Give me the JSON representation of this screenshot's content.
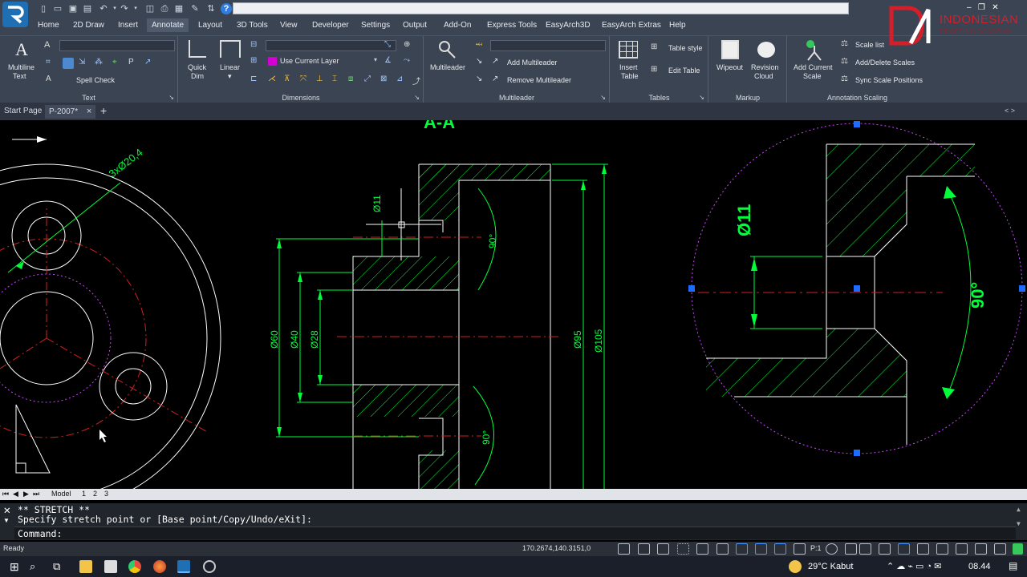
{
  "titlebar": {
    "brand_text": "INDONESIAN",
    "brand_subtext": "DRAFTING ACADEMY"
  },
  "menu": {
    "items": [
      "Home",
      "2D Draw",
      "Insert",
      "Annotate",
      "Layout",
      "3D Tools",
      "View",
      "Developer",
      "Settings",
      "Output",
      "Add-On",
      "Express Tools",
      "EasyArch3D",
      "EasyArch Extras",
      "Help"
    ],
    "active": "Annotate"
  },
  "ribbon": {
    "text": {
      "title": "Text",
      "multiline_text": "Multiline",
      "multiline_text2": "Text",
      "spell_check": "Spell Check"
    },
    "dimensions": {
      "title": "Dimensions",
      "quick_dim": "Quick",
      "quick_dim2": "Dim",
      "linear": "Linear",
      "layer": "Use Current Layer",
      "layer_color": "#d400d4"
    },
    "multileader": {
      "title": "Multileader",
      "multileader": "Multileader",
      "add": "Add Multileader",
      "remove": "Remove Multileader"
    },
    "tables": {
      "title": "Tables",
      "insert_table": "Insert",
      "insert_table2": "Table",
      "table_style": "Table style",
      "edit_table": "Edit Table"
    },
    "markup": {
      "title": "Markup",
      "wipeout": "Wipeout",
      "revision_cloud": "Revision",
      "revision_cloud2": "Cloud"
    },
    "annotation_scaling": {
      "title": "Annotation Scaling",
      "add_current_scale": "Add Current",
      "add_current_scale2": "Scale",
      "scale_list": "Scale list",
      "add_delete_scales": "Add/Delete Scales",
      "sync_scale_positions": "Sync Scale Positions"
    }
  },
  "tabs": {
    "start_page": "Start Page",
    "active_doc": "P-2007*",
    "close_icon": "×",
    "new_tab_icon": "+"
  },
  "drawing": {
    "section_label": "A-A",
    "dim_hole_pattern": "3xØ20,4",
    "dim_d11": "Ø11",
    "dim_90_top": "90°",
    "dim_90_bottom": "90°",
    "dim_d60": "Ø60",
    "dim_d40": "Ø40",
    "dim_d28": "Ø28",
    "dim_d95": "Ø95",
    "dim_d105": "Ø105",
    "detail_d11": "Ø11",
    "detail_90": "90°",
    "colors": {
      "dimension": "#00ff3a",
      "centerline": "#d42020",
      "geometry": "#ffffff",
      "circle_boundary": "#cc44ff",
      "grip": "#1e6bff"
    }
  },
  "layout_tabs": {
    "items": [
      "Model",
      "1",
      "2",
      "3"
    ]
  },
  "command": {
    "line1": "** STRETCH **",
    "line2": "Specify stretch point or [Base point/Copy/Undo/eXit]:",
    "prompt": "Command:"
  },
  "status": {
    "ready": "Ready",
    "coordinates": "170.2674,140.3151,0",
    "paper_label": "P:1"
  },
  "taskbar": {
    "weather": "29°C  Kabut",
    "time": "08.44"
  }
}
